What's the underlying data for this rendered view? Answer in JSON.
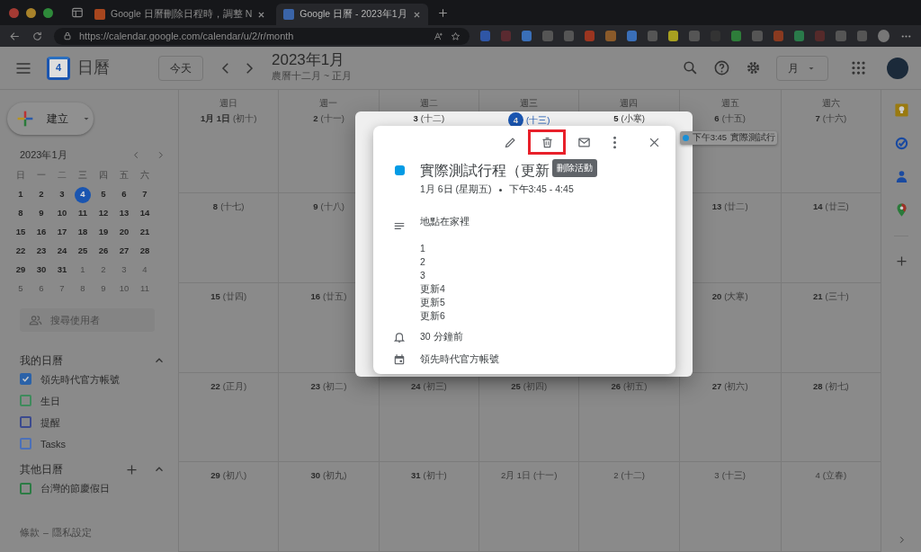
{
  "browser": {
    "tabs": [
      {
        "title": "Google 日曆刪除日程時，調整 N",
        "selected": false
      },
      {
        "title": "Google 日曆 - 2023年1月",
        "selected": true
      }
    ],
    "url": "https://calendar.google.com/calendar/u/2/r/month"
  },
  "header": {
    "logo_day": "4",
    "app_name": "日曆",
    "today_button": "今天",
    "title": "2023年1月",
    "subtitle": "農曆十二月 ~ 正月",
    "view": "月"
  },
  "sidebar": {
    "create_button": "建立",
    "mini_calendar": {
      "title": "2023年1月",
      "weekdays": [
        "日",
        "一",
        "二",
        "三",
        "四",
        "五",
        "六"
      ],
      "weeks": [
        [
          {
            "day": "1",
            "outside": false,
            "selected": false
          },
          {
            "day": "2",
            "outside": false,
            "selected": false
          },
          {
            "day": "3",
            "outside": false,
            "selected": false
          },
          {
            "day": "4",
            "outside": false,
            "selected": true
          },
          {
            "day": "5",
            "outside": false,
            "selected": false
          },
          {
            "day": "6",
            "outside": false,
            "selected": false
          },
          {
            "day": "7",
            "outside": false,
            "selected": false
          }
        ],
        [
          {
            "day": "8",
            "outside": false,
            "selected": false
          },
          {
            "day": "9",
            "outside": false,
            "selected": false
          },
          {
            "day": "10",
            "outside": false,
            "selected": false
          },
          {
            "day": "11",
            "outside": false,
            "selected": false
          },
          {
            "day": "12",
            "outside": false,
            "selected": false
          },
          {
            "day": "13",
            "outside": false,
            "selected": false
          },
          {
            "day": "14",
            "outside": false,
            "selected": false
          }
        ],
        [
          {
            "day": "15",
            "outside": false,
            "selected": false
          },
          {
            "day": "16",
            "outside": false,
            "selected": false
          },
          {
            "day": "17",
            "outside": false,
            "selected": false
          },
          {
            "day": "18",
            "outside": false,
            "selected": false
          },
          {
            "day": "19",
            "outside": false,
            "selected": false
          },
          {
            "day": "20",
            "outside": false,
            "selected": false
          },
          {
            "day": "21",
            "outside": false,
            "selected": false
          }
        ],
        [
          {
            "day": "22",
            "outside": false,
            "selected": false
          },
          {
            "day": "23",
            "outside": false,
            "selected": false
          },
          {
            "day": "24",
            "outside": false,
            "selected": false
          },
          {
            "day": "25",
            "outside": false,
            "selected": false
          },
          {
            "day": "26",
            "outside": false,
            "selected": false
          },
          {
            "day": "27",
            "outside": false,
            "selected": false
          },
          {
            "day": "28",
            "outside": false,
            "selected": false
          }
        ],
        [
          {
            "day": "29",
            "outside": false,
            "selected": false
          },
          {
            "day": "30",
            "outside": false,
            "selected": false
          },
          {
            "day": "31",
            "outside": false,
            "selected": false
          },
          {
            "day": "1",
            "outside": true,
            "selected": false
          },
          {
            "day": "2",
            "outside": true,
            "selected": false
          },
          {
            "day": "3",
            "outside": true,
            "selected": false
          },
          {
            "day": "4",
            "outside": true,
            "selected": false
          }
        ],
        [
          {
            "day": "5",
            "outside": true,
            "selected": false
          },
          {
            "day": "6",
            "outside": true,
            "selected": false
          },
          {
            "day": "7",
            "outside": true,
            "selected": false
          },
          {
            "day": "8",
            "outside": true,
            "selected": false
          },
          {
            "day": "9",
            "outside": true,
            "selected": false
          },
          {
            "day": "10",
            "outside": true,
            "selected": false
          },
          {
            "day": "11",
            "outside": true,
            "selected": false
          }
        ]
      ]
    },
    "search_people": {
      "placeholder": "搜尋使用者"
    },
    "my_calendars": {
      "title": "我的日曆",
      "expanded": true,
      "items": [
        {
          "label": "領先時代官方帳號",
          "checked": true,
          "color": "#2b62a8"
        },
        {
          "label": "生日",
          "checked": false,
          "color": "#3f8a5c"
        },
        {
          "label": "提醒",
          "checked": false,
          "color": "#3b4a8e"
        },
        {
          "label": "Tasks",
          "checked": false,
          "color": "#4c70b8"
        }
      ]
    },
    "other_calendars": {
      "title": "其他日曆",
      "expanded": true,
      "items": [
        {
          "label": "台灣的節慶假日",
          "checked": false,
          "color": "#2c7b44"
        }
      ]
    },
    "footer": {
      "links": [
        "條款",
        "隱私設定"
      ],
      "separator": "–"
    }
  },
  "month": {
    "weekdays": [
      "週日",
      "週一",
      "週二",
      "週三",
      "週四",
      "週五",
      "週六"
    ],
    "weeks": [
      {
        "left": [
          {
            "day": "1月 1日",
            "lunar": "(初十)",
            "today": false,
            "outside": false
          },
          {
            "day": "2",
            "lunar": "(十一)",
            "today": false,
            "outside": false
          },
          {
            "day": "3",
            "lunar": "(十二)",
            "today": false,
            "outside": false
          },
          {
            "day": "4",
            "lunar": "(十三)",
            "today": true,
            "outside": false
          },
          {
            "day": "5",
            "lunar": "(小寒)",
            "today": false,
            "outside": false
          },
          {
            "day": "6",
            "lunar": "(十五)",
            "today": false,
            "outside": false,
            "events": [
              {
                "time": "下午3:45",
                "title": "實際測試行",
                "color": "#1a8fd6"
              }
            ]
          },
          {
            "day": "7",
            "lunar": "(十六)",
            "today": false,
            "outside": false
          }
        ]
      },
      {
        "left": [
          {
            "day": "8",
            "lunar": "(十七)",
            "today": false,
            "outside": false
          },
          {
            "day": "9",
            "lunar": "(十八)",
            "today": false,
            "outside": false
          }
        ],
        "right": [
          {
            "day": "13",
            "lunar": "(廿二)",
            "today": false,
            "outside": false
          },
          {
            "day": "14",
            "lunar": "(廿三)",
            "today": false,
            "outside": false
          }
        ]
      },
      {
        "left": [
          {
            "day": "15",
            "lunar": "(廿四)",
            "today": false,
            "outside": false
          },
          {
            "day": "16",
            "lunar": "(廿五)",
            "today": false,
            "outside": false
          }
        ],
        "right": [
          {
            "day": "20",
            "lunar": "(大寒)",
            "today": false,
            "outside": false
          },
          {
            "day": "21",
            "lunar": "(三十)",
            "today": false,
            "outside": false
          }
        ]
      },
      {
        "left": [
          {
            "day": "22",
            "lunar": "(正月)",
            "today": false,
            "outside": false
          },
          {
            "day": "23",
            "lunar": "(初二)",
            "today": false,
            "outside": false
          },
          {
            "day": "24",
            "lunar": "(初三)",
            "today": false,
            "outside": false
          },
          {
            "day": "25",
            "lunar": "(初四)",
            "today": false,
            "outside": false
          },
          {
            "day": "26",
            "lunar": "(初五)",
            "today": false,
            "outside": false
          },
          {
            "day": "27",
            "lunar": "(初六)",
            "today": false,
            "outside": false
          },
          {
            "day": "28",
            "lunar": "(初七)",
            "today": false,
            "outside": false
          }
        ]
      },
      {
        "left": [
          {
            "day": "29",
            "lunar": "(初八)",
            "today": false,
            "outside": false
          },
          {
            "day": "30",
            "lunar": "(初九)",
            "today": false,
            "outside": false
          },
          {
            "day": "31",
            "lunar": "(初十)",
            "today": false,
            "outside": false
          },
          {
            "day": "2月 1日",
            "lunar": "(十一)",
            "today": false,
            "outside": true
          },
          {
            "day": "2",
            "lunar": "(十二)",
            "today": false,
            "outside": true
          },
          {
            "day": "3",
            "lunar": "(十三)",
            "today": false,
            "outside": true
          },
          {
            "day": "4",
            "lunar": "(立春)",
            "today": false,
            "outside": true
          }
        ]
      }
    ]
  },
  "event_popup": {
    "actions": [
      {
        "kind": "edit",
        "highlighted": false
      },
      {
        "kind": "delete",
        "highlighted": true
      },
      {
        "kind": "email",
        "highlighted": false
      },
      {
        "kind": "more",
        "highlighted": false
      },
      {
        "kind": "close",
        "highlighted": false
      }
    ],
    "tooltip": "刪除活動",
    "color": "#039be5",
    "title": "實際測試行程（更新",
    "date": "1月 6日 (星期五)",
    "time": "下午3:45 - 4:45",
    "description": [
      "地點在家裡",
      "1",
      "2",
      "3",
      "更新4",
      "更新5",
      "更新6"
    ],
    "reminder": "30 分鐘前",
    "calendar": "領先時代官方帳號"
  }
}
